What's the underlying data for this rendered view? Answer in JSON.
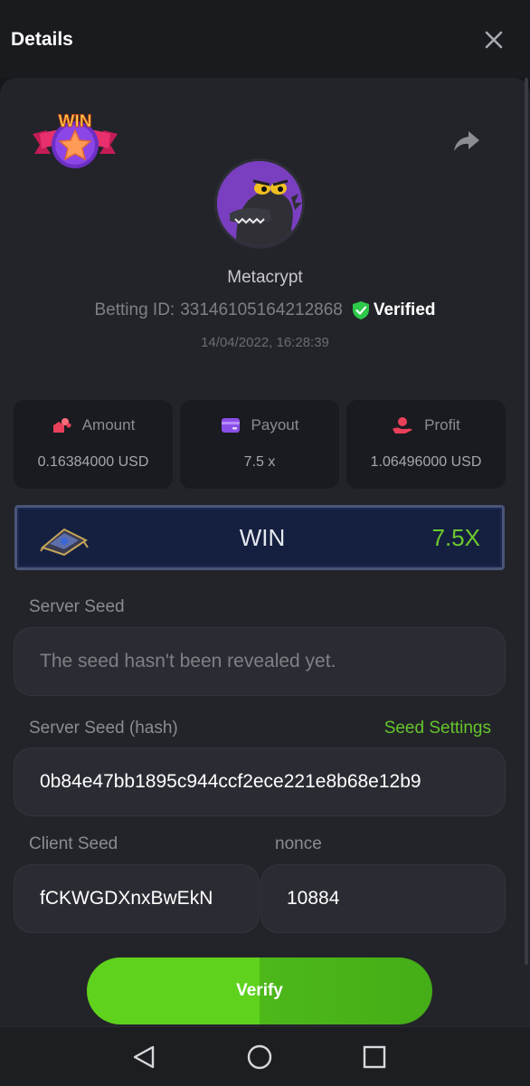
{
  "header": {
    "title": "Details"
  },
  "icons": {
    "close": "close-icon",
    "share": "share-icon",
    "win_badge": "win-badge-icon",
    "verified": "verified-shield-icon",
    "amount": "amount-icon",
    "payout": "payout-icon",
    "profit": "profit-icon",
    "treasure": "treasure-icon"
  },
  "badge": {
    "text": "WIN"
  },
  "user": {
    "name": "Metacrypt",
    "betting_id_label": "Betting ID:",
    "betting_id": "33146105164212868",
    "verified_label": "Verified",
    "timestamp": "14/04/2022, 16:28:39"
  },
  "stats": {
    "amount": {
      "label": "Amount",
      "value": "0.16384000 USD"
    },
    "payout": {
      "label": "Payout",
      "value": "7.5 x"
    },
    "profit": {
      "label": "Profit",
      "value": "1.06496000 USD"
    }
  },
  "result": {
    "label": "WIN",
    "multiplier": "7.5X"
  },
  "server_seed": {
    "label": "Server Seed",
    "placeholder": "The seed hasn't been revealed yet."
  },
  "server_seed_hash": {
    "label": "Server Seed (hash)",
    "settings_link": "Seed Settings",
    "value": "0b84e47bb1895c944ccf2ece221e8b68e12b9"
  },
  "client_seed": {
    "label": "Client Seed",
    "value": "fCKWGDXnxBwEkN"
  },
  "nonce": {
    "label": "nonce",
    "value": "10884"
  },
  "verify_button": {
    "label": "Verify"
  },
  "colors": {
    "background": "#16171b",
    "card": "#23242a",
    "accent_green": "#5fd21e",
    "verified_green": "#2ec84a",
    "multiplier_green": "#6cc92d",
    "payout_purple": "#8a4fe6",
    "amount_red": "#e8405a"
  }
}
